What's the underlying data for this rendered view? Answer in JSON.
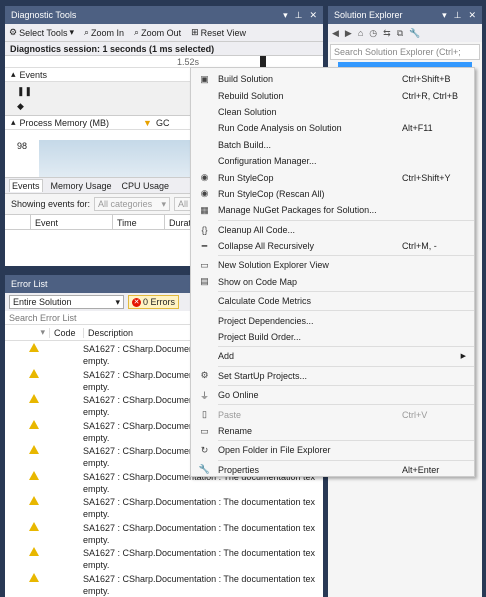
{
  "diagnostic_tools": {
    "title": "Diagnostic Tools",
    "toolbar": {
      "select_tools": "Select Tools",
      "zoom_in": "Zoom In",
      "zoom_out": "Zoom Out",
      "reset_view": "Reset View"
    },
    "session": "Diagnostics session: 1 seconds (1 ms selected)",
    "ruler_label": "1.52s",
    "events_label": "Events",
    "process_memory": {
      "label": "Process Memory (MB)",
      "gc_label": "GC",
      "value": "98"
    },
    "tabs": [
      "Events",
      "Memory Usage",
      "CPU Usage"
    ],
    "filter": {
      "label": "Showing events for:",
      "categories": "All categories",
      "all": "All"
    },
    "columns": [
      "Event",
      "Time",
      "Duratio"
    ]
  },
  "error_list": {
    "title": "Error List",
    "scope": "Entire Solution",
    "errors_badge": "0 Errors",
    "search_placeholder": "Search Error List",
    "columns": {
      "code": "Code",
      "description": "Description"
    },
    "rows": [
      {
        "line1": "SA1627 : CSharp.Documentation",
        "line2": "empty."
      },
      {
        "line1": "SA1627 : CSharp.Documentation",
        "line2": "empty."
      },
      {
        "line1": "SA1627 : CSharp.Documentation",
        "line2": "empty."
      },
      {
        "line1": "SA1627 : CSharp.Documentation",
        "line2": "empty."
      },
      {
        "line1": "SA1627 : CSharp.Documentation",
        "line2": "empty."
      },
      {
        "line1": "SA1627 : CSharp.Documentation : The documentation tex",
        "line2": "empty."
      },
      {
        "line1": "SA1627 : CSharp.Documentation : The documentation tex",
        "line2": "empty."
      },
      {
        "line1": "SA1627 : CSharp.Documentation : The documentation tex",
        "line2": "empty."
      },
      {
        "line1": "SA1627 : CSharp.Documentation : The documentation tex",
        "line2": "empty."
      },
      {
        "line1": "SA1627 : CSharp.Documentation : The documentation tex",
        "line2": "empty."
      }
    ]
  },
  "solution_explorer": {
    "title": "Solution Explorer",
    "search_placeholder": "Search Solution Explorer (Ctrl+;"
  },
  "context_menu": {
    "items": [
      {
        "label": "Build Solution",
        "shortcut": "Ctrl+Shift+B",
        "icon": "build-icon",
        "glyph": "▣"
      },
      {
        "label": "Rebuild Solution",
        "shortcut": "Ctrl+R, Ctrl+B",
        "icon": "",
        "glyph": ""
      },
      {
        "label": "Clean Solution",
        "shortcut": "",
        "icon": "",
        "glyph": ""
      },
      {
        "label": "Run Code Analysis on Solution",
        "shortcut": "Alt+F11",
        "icon": "",
        "glyph": ""
      },
      {
        "label": "Batch Build...",
        "shortcut": "",
        "icon": "",
        "glyph": ""
      },
      {
        "label": "Configuration Manager...",
        "shortcut": "",
        "icon": "",
        "glyph": ""
      },
      {
        "label": "Run StyleCop",
        "shortcut": "Ctrl+Shift+Y",
        "icon": "stylecop-icon",
        "glyph": "◉"
      },
      {
        "label": "Run StyleCop (Rescan All)",
        "shortcut": "",
        "icon": "stylecop-icon",
        "glyph": "◉"
      },
      {
        "label": "Manage NuGet Packages for Solution...",
        "shortcut": "",
        "icon": "nuget-icon",
        "glyph": "▦"
      },
      {
        "sep": true
      },
      {
        "label": "Cleanup All Code...",
        "shortcut": "",
        "icon": "cleanup-icon",
        "glyph": "{}"
      },
      {
        "label": "Collapse All Recursively",
        "shortcut": "Ctrl+M, -",
        "icon": "collapse-icon",
        "glyph": "━"
      },
      {
        "sep": true
      },
      {
        "label": "New Solution Explorer View",
        "shortcut": "",
        "icon": "new-view-icon",
        "glyph": "▭"
      },
      {
        "label": "Show on Code Map",
        "shortcut": "",
        "icon": "code-map-icon",
        "glyph": "▤"
      },
      {
        "sep": true
      },
      {
        "label": "Calculate Code Metrics",
        "shortcut": "",
        "icon": "",
        "glyph": ""
      },
      {
        "sep": true
      },
      {
        "label": "Project Dependencies...",
        "shortcut": "",
        "icon": "",
        "glyph": ""
      },
      {
        "label": "Project Build Order...",
        "shortcut": "",
        "icon": "",
        "glyph": ""
      },
      {
        "sep": true
      },
      {
        "label": "Add",
        "shortcut": "",
        "icon": "",
        "glyph": "",
        "submenu": true
      },
      {
        "sep": true
      },
      {
        "label": "Set StartUp Projects...",
        "shortcut": "",
        "icon": "gear-icon",
        "glyph": "⚙"
      },
      {
        "sep": true
      },
      {
        "label": "Go Online",
        "shortcut": "",
        "icon": "plug-icon",
        "glyph": "⏚"
      },
      {
        "sep": true
      },
      {
        "label": "Paste",
        "shortcut": "Ctrl+V",
        "icon": "paste-icon",
        "glyph": "▯",
        "disabled": true
      },
      {
        "label": "Rename",
        "shortcut": "",
        "icon": "rename-icon",
        "glyph": "▭"
      },
      {
        "sep": true
      },
      {
        "label": "Open Folder in File Explorer",
        "shortcut": "",
        "icon": "folder-icon",
        "glyph": "↻"
      },
      {
        "sep": true
      },
      {
        "label": "Properties",
        "shortcut": "Alt+Enter",
        "icon": "wrench-icon",
        "glyph": "🔧"
      }
    ]
  }
}
